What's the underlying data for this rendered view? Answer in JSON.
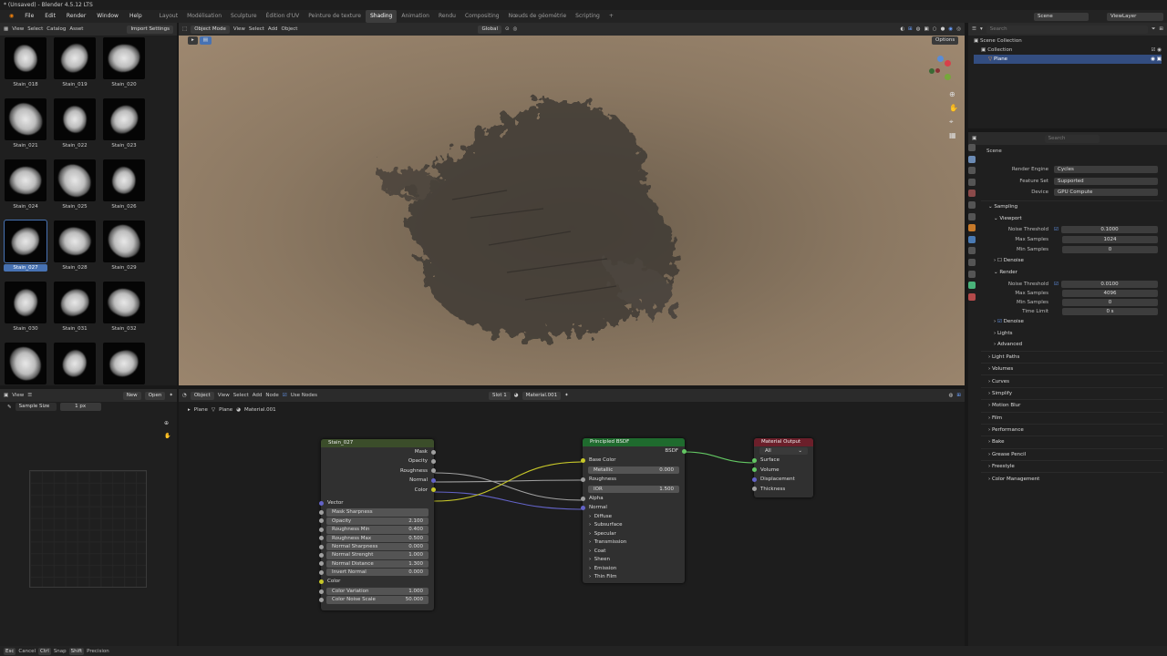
{
  "window_title": "* (Unsaved) - Blender 4.5.12 LTS",
  "menu": [
    "File",
    "Edit",
    "Render",
    "Window",
    "Help"
  ],
  "workspaces": [
    "Layout",
    "Modélisation",
    "Sculpture",
    "Édition d'UV",
    "Peinture de texture",
    "Shading",
    "Animation",
    "Rendu",
    "Compositing",
    "Nœuds de géométrie",
    "Scripting"
  ],
  "active_workspace": "Shading",
  "scene": {
    "name": "Scene",
    "view_layer": "ViewLayer"
  },
  "asset_browser": {
    "header": [
      "View",
      "Select",
      "Catalog",
      "Asset"
    ],
    "import_settings": "Import Settings",
    "thumbnails": [
      "Stain_018",
      "Stain_019",
      "Stain_020",
      "Stain_021",
      "Stain_022",
      "Stain_023",
      "Stain_024",
      "Stain_025",
      "Stain_026",
      "Stain_027",
      "Stain_028",
      "Stain_029",
      "Stain_030",
      "Stain_031",
      "Stain_032",
      "",
      "",
      ""
    ],
    "selected": "Stain_027"
  },
  "viewport": {
    "mode": "Object Mode",
    "menus": [
      "View",
      "Select",
      "Add",
      "Object"
    ],
    "orientation": "Global",
    "options": "Options"
  },
  "image_editor": {
    "view": "View",
    "new": "New",
    "open": "Open",
    "sample_size_label": "Sample Size",
    "sample_size_value": "1 px"
  },
  "node_editor": {
    "type": "Object",
    "menus": [
      "View",
      "Select",
      "Add",
      "Node"
    ],
    "use_nodes": "Use Nodes",
    "slot": "Slot 1",
    "material": "Material.001",
    "breadcrumb": [
      "Plane",
      "Plane",
      "Material.001"
    ]
  },
  "stain_node": {
    "title": "Stain_027",
    "outputs": [
      "Mask",
      "Opacity",
      "Roughness",
      "Normal",
      "Color"
    ],
    "vector_label": "Vector",
    "fields": [
      {
        "label": "Mask Sharpness",
        "value": ""
      },
      {
        "label": "Opacity",
        "value": "2.100"
      },
      {
        "label": "Roughness Min",
        "value": "0.400"
      },
      {
        "label": "Roughness Max",
        "value": "0.500"
      },
      {
        "label": "Normal Sharpness",
        "value": "0.000"
      },
      {
        "label": "Normal Strenght",
        "value": "1.000"
      },
      {
        "label": "Normal Distance",
        "value": "1.300"
      },
      {
        "label": "Invert Normal",
        "value": "0.000"
      }
    ],
    "color_label": "Color",
    "fields2": [
      {
        "label": "Color Variation",
        "value": "1.000"
      },
      {
        "label": "Color Noise Scale",
        "value": "50.000"
      }
    ]
  },
  "bsdf_node": {
    "title": "Principled BSDF",
    "output": "BSDF",
    "base_color": "Base Color",
    "metallic": {
      "label": "Metallic",
      "value": "0.000"
    },
    "roughness": "Roughness",
    "ior": {
      "label": "IOR",
      "value": "1.500"
    },
    "alpha": "Alpha",
    "normal": "Normal",
    "panels": [
      "Diffuse",
      "Subsurface",
      "Specular",
      "Transmission",
      "Coat",
      "Sheen",
      "Emission",
      "Thin Film"
    ]
  },
  "output_node": {
    "title": "Material Output",
    "target": "All",
    "inputs": [
      "Surface",
      "Volume",
      "Displacement",
      "Thickness"
    ]
  },
  "outliner": {
    "root": "Scene Collection",
    "collection": "Collection",
    "object": "Plane"
  },
  "properties": {
    "scene_label": "Scene",
    "search_placeholder": "Search",
    "render_engine": {
      "label": "Render Engine",
      "value": "Cycles"
    },
    "feature_set": {
      "label": "Feature Set",
      "value": "Supported"
    },
    "device": {
      "label": "Device",
      "value": "GPU Compute"
    },
    "sampling": "Sampling",
    "viewport": "Viewport",
    "vp_noise_threshold": {
      "label": "Noise Threshold",
      "value": "0.1000"
    },
    "vp_max_samples": {
      "label": "Max Samples",
      "value": "1024"
    },
    "vp_min_samples": {
      "label": "Min Samples",
      "value": "0"
    },
    "denoise": "Denoise",
    "render": "Render",
    "r_noise_threshold": {
      "label": "Noise Threshold",
      "value": "0.0100"
    },
    "r_max_samples": {
      "label": "Max Samples",
      "value": "4096"
    },
    "r_min_samples": {
      "label": "Min Samples",
      "value": "0"
    },
    "r_time_limit": {
      "label": "Time Limit",
      "value": "0 s"
    },
    "sub_sections": [
      "Denoise",
      "Lights",
      "Advanced"
    ],
    "sections": [
      "Light Paths",
      "Volumes",
      "Curves",
      "Simplify",
      "Motion Blur",
      "Film",
      "Performance",
      "Bake",
      "Grease Pencil",
      "Freestyle",
      "Color Management"
    ]
  },
  "statusbar": {
    "cancel": "Cancel",
    "snap": "Snap",
    "precision": "Precision",
    "esc": "Esc",
    "ctrl": "Ctrl",
    "shift": "Shift"
  },
  "colors": {
    "accent": "#4772b3",
    "shader_header": "#1f6b2e",
    "texture_header": "#3b4d2a",
    "output_header": "#6b1f2a"
  }
}
